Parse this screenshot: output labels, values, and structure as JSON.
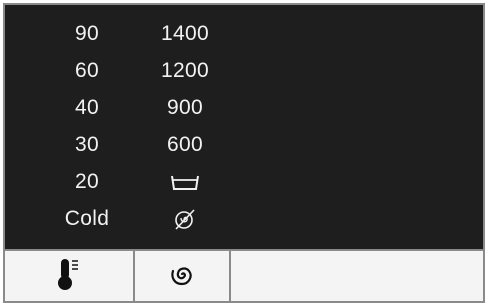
{
  "temperature": {
    "options": [
      "90",
      "60",
      "40",
      "30",
      "20",
      "Cold"
    ]
  },
  "spin": {
    "options": [
      "1400",
      "1200",
      "900",
      "600"
    ],
    "icons": [
      "rinse-hold-icon",
      "no-spin-icon"
    ]
  },
  "buttons": {
    "temperature_icon": "thermometer-icon",
    "spin_icon": "spiral-icon"
  },
  "colors": {
    "display_bg": "#1e1e1e",
    "display_text": "#f2f2f2",
    "button_bar_bg": "#f4f4f4",
    "border": "#8a8a8a"
  }
}
